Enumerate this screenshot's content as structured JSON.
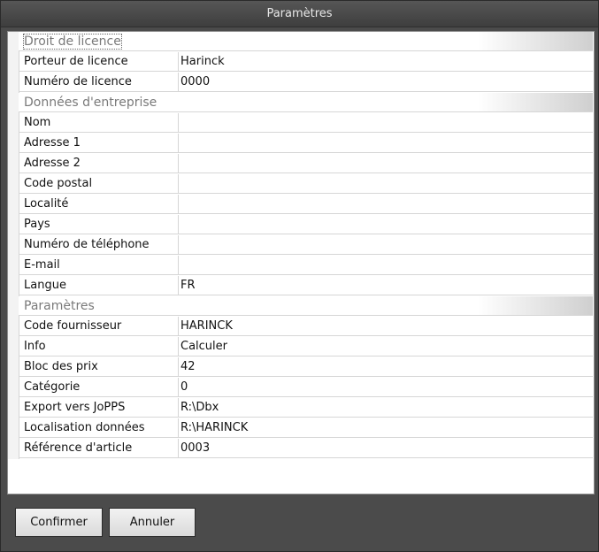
{
  "window": {
    "title": "Paramètres"
  },
  "sections": {
    "license": {
      "header": "Droit de licence",
      "rows": [
        {
          "key": "Porteur de licence",
          "value": "Harinck"
        },
        {
          "key": "Numéro de licence",
          "value": "0000"
        }
      ]
    },
    "company": {
      "header": "Données d'entreprise",
      "rows": [
        {
          "key": "Nom",
          "value": ""
        },
        {
          "key": "Adresse 1",
          "value": ""
        },
        {
          "key": "Adresse 2",
          "value": ""
        },
        {
          "key": "Code postal",
          "value": ""
        },
        {
          "key": "Localité",
          "value": ""
        },
        {
          "key": "Pays",
          "value": ""
        },
        {
          "key": "Numéro de téléphone",
          "value": ""
        },
        {
          "key": "E-mail",
          "value": ""
        },
        {
          "key": "Langue",
          "value": "FR"
        }
      ]
    },
    "settings": {
      "header": "Paramètres",
      "rows": [
        {
          "key": "Code fournisseur",
          "value": "HARINCK"
        },
        {
          "key": "Info",
          "value": "Calculer"
        },
        {
          "key": "Bloc des prix",
          "value": "42"
        },
        {
          "key": "Catégorie",
          "value": "0"
        },
        {
          "key": "Export vers JoPPS",
          "value": "R:\\Dbx"
        },
        {
          "key": "Localisation données",
          "value": "R:\\HARINCK"
        },
        {
          "key": "Référence d'article",
          "value": "0003"
        }
      ]
    }
  },
  "buttons": {
    "confirm": "Confirmer",
    "cancel": "Annuler"
  }
}
